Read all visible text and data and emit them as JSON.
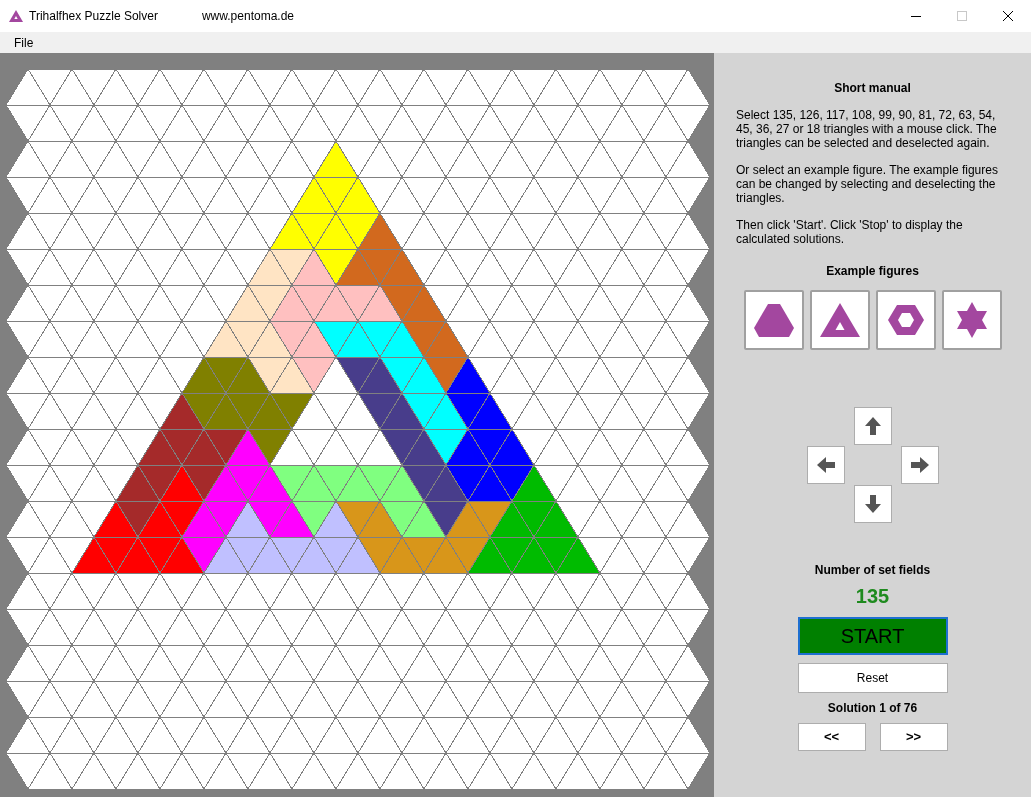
{
  "window": {
    "title": "Trihalfhex Puzzle Solver",
    "subtitle": "www.pentoma.de"
  },
  "menu": [
    "File"
  ],
  "board": {
    "rows": [
      [
        {
          "color": "#ffffff"
        },
        {
          "color": "#ffffff"
        },
        {
          "color": "#ffffff"
        },
        {
          "color": "#ffffff"
        },
        {
          "color": "#ffffff"
        },
        {
          "color": "#ffffff"
        },
        {
          "color": "#ffffff"
        },
        {
          "color": "#ffffff"
        },
        {
          "color": "#ffffff"
        },
        {
          "color": "#ffffff"
        },
        {
          "color": "#ffffff"
        },
        {
          "color": "#ffffff"
        },
        {
          "color": "#ffffff"
        },
        {
          "color": "#ffffff"
        },
        {
          "color": "#ffffff"
        },
        {
          "color": "#ffffff"
        },
        {
          "color": "#ffffff"
        },
        {
          "color": "#ffffff"
        },
        {
          "color": "#ffffff"
        },
        {
          "color": "#ffffff"
        },
        {
          "color": "#ffffff"
        },
        {
          "color": "#ffffff"
        },
        {
          "color": "#ffffff"
        },
        {
          "color": "#ffffff"
        },
        {
          "color": "#ffffff"
        },
        {
          "color": "#ffffff"
        },
        {
          "color": "#ffffff"
        },
        {
          "color": "#ffffff"
        },
        {
          "color": "#ffffff"
        },
        {
          "color": "#ffffff"
        },
        {
          "color": "#ffffff"
        }
      ],
      [
        {
          "color": "#ffffff"
        },
        {
          "color": "#ffffff"
        },
        {
          "color": "#ffffff"
        },
        {
          "color": "#ffffff"
        },
        {
          "color": "#ffffff"
        },
        {
          "color": "#ffffff"
        },
        {
          "color": "#ffffff"
        },
        {
          "color": "#ffffff"
        },
        {
          "color": "#ffffff"
        },
        {
          "color": "#ffffff"
        },
        {
          "color": "#ffffff"
        },
        {
          "color": "#ffffff"
        },
        {
          "color": "#ffffff"
        },
        {
          "color": "#ffffff"
        },
        {
          "color": "#ffffff"
        },
        {
          "color": "#ffffff"
        },
        {
          "color": "#ffffff"
        },
        {
          "color": "#ffffff"
        },
        {
          "color": "#ffffff"
        },
        {
          "color": "#ffffff"
        },
        {
          "color": "#ffffff"
        },
        {
          "color": "#ffffff"
        },
        {
          "color": "#ffffff"
        },
        {
          "color": "#ffffff"
        },
        {
          "color": "#ffffff"
        },
        {
          "color": "#ffffff"
        },
        {
          "color": "#ffffff"
        },
        {
          "color": "#ffffff"
        },
        {
          "color": "#ffffff"
        },
        {
          "color": "#ffffff"
        },
        {
          "color": "#ffffff"
        }
      ],
      [
        {
          "color": "#ffffff"
        },
        {
          "color": "#ffffff"
        },
        {
          "color": "#ffffff"
        },
        {
          "color": "#ffffff"
        },
        {
          "color": "#ffffff"
        },
        {
          "color": "#ffffff"
        },
        {
          "color": "#ffffff"
        },
        {
          "color": "#ffffff"
        },
        {
          "color": "#ffffff"
        },
        {
          "color": "#ffffff"
        },
        {
          "color": "#ffffff"
        },
        {
          "color": "#ffffff"
        },
        {
          "color": "#ffffff"
        },
        {
          "color": "#ffffff"
        },
        {
          "color": "#ffff00"
        },
        {
          "color": "#ffffff"
        },
        {
          "color": "#ffffff"
        },
        {
          "color": "#ffffff"
        },
        {
          "color": "#ffffff"
        },
        {
          "color": "#ffffff"
        },
        {
          "color": "#ffffff"
        },
        {
          "color": "#ffffff"
        },
        {
          "color": "#ffffff"
        },
        {
          "color": "#ffffff"
        },
        {
          "color": "#ffffff"
        },
        {
          "color": "#ffffff"
        },
        {
          "color": "#ffffff"
        },
        {
          "color": "#ffffff"
        },
        {
          "color": "#ffffff"
        },
        {
          "color": "#ffffff"
        },
        {
          "color": "#ffffff"
        }
      ],
      [
        {
          "color": "#ffffff"
        },
        {
          "color": "#ffffff"
        },
        {
          "color": "#ffffff"
        },
        {
          "color": "#ffffff"
        },
        {
          "color": "#ffffff"
        },
        {
          "color": "#ffffff"
        },
        {
          "color": "#ffffff"
        },
        {
          "color": "#ffffff"
        },
        {
          "color": "#ffffff"
        },
        {
          "color": "#ffffff"
        },
        {
          "color": "#ffffff"
        },
        {
          "color": "#ffffff"
        },
        {
          "color": "#ffffff"
        },
        {
          "color": "#ffff00"
        },
        {
          "color": "#ffff00"
        },
        {
          "color": "#ffff00"
        },
        {
          "color": "#ffffff"
        },
        {
          "color": "#ffffff"
        },
        {
          "color": "#ffffff"
        },
        {
          "color": "#ffffff"
        },
        {
          "color": "#ffffff"
        },
        {
          "color": "#ffffff"
        },
        {
          "color": "#ffffff"
        },
        {
          "color": "#ffffff"
        },
        {
          "color": "#ffffff"
        },
        {
          "color": "#ffffff"
        },
        {
          "color": "#ffffff"
        },
        {
          "color": "#ffffff"
        },
        {
          "color": "#ffffff"
        },
        {
          "color": "#ffffff"
        },
        {
          "color": "#ffffff"
        }
      ],
      [
        {
          "color": "#ffffff"
        },
        {
          "color": "#ffffff"
        },
        {
          "color": "#ffffff"
        },
        {
          "color": "#ffffff"
        },
        {
          "color": "#ffffff"
        },
        {
          "color": "#ffffff"
        },
        {
          "color": "#ffffff"
        },
        {
          "color": "#ffffff"
        },
        {
          "color": "#ffffff"
        },
        {
          "color": "#ffffff"
        },
        {
          "color": "#ffffff"
        },
        {
          "color": "#ffffff"
        },
        {
          "color": "#ffff00"
        },
        {
          "color": "#ffff00"
        },
        {
          "color": "#ffff00"
        },
        {
          "color": "#ffff00"
        },
        {
          "color": "#d2691e"
        },
        {
          "color": "#ffffff"
        },
        {
          "color": "#ffffff"
        },
        {
          "color": "#ffffff"
        },
        {
          "color": "#ffffff"
        },
        {
          "color": "#ffffff"
        },
        {
          "color": "#ffffff"
        },
        {
          "color": "#ffffff"
        },
        {
          "color": "#ffffff"
        },
        {
          "color": "#ffffff"
        },
        {
          "color": "#ffffff"
        },
        {
          "color": "#ffffff"
        },
        {
          "color": "#ffffff"
        },
        {
          "color": "#ffffff"
        },
        {
          "color": "#ffffff"
        }
      ],
      [
        {
          "color": "#ffffff"
        },
        {
          "color": "#ffffff"
        },
        {
          "color": "#ffffff"
        },
        {
          "color": "#ffffff"
        },
        {
          "color": "#ffffff"
        },
        {
          "color": "#ffffff"
        },
        {
          "color": "#ffffff"
        },
        {
          "color": "#ffffff"
        },
        {
          "color": "#ffffff"
        },
        {
          "color": "#ffffff"
        },
        {
          "color": "#ffffff"
        },
        {
          "color": "#ffe4c4"
        },
        {
          "color": "#ffe4c4"
        },
        {
          "color": "#ffc0c0"
        },
        {
          "color": "#ffff00"
        },
        {
          "color": "#d2691e"
        },
        {
          "color": "#d2691e"
        },
        {
          "color": "#d2691e"
        },
        {
          "color": "#ffffff"
        },
        {
          "color": "#ffffff"
        },
        {
          "color": "#ffffff"
        },
        {
          "color": "#ffffff"
        },
        {
          "color": "#ffffff"
        },
        {
          "color": "#ffffff"
        },
        {
          "color": "#ffffff"
        },
        {
          "color": "#ffffff"
        },
        {
          "color": "#ffffff"
        },
        {
          "color": "#ffffff"
        },
        {
          "color": "#ffffff"
        },
        {
          "color": "#ffffff"
        },
        {
          "color": "#ffffff"
        }
      ],
      [
        {
          "color": "#ffffff"
        },
        {
          "color": "#ffffff"
        },
        {
          "color": "#ffffff"
        },
        {
          "color": "#ffffff"
        },
        {
          "color": "#ffffff"
        },
        {
          "color": "#ffffff"
        },
        {
          "color": "#ffffff"
        },
        {
          "color": "#ffffff"
        },
        {
          "color": "#ffffff"
        },
        {
          "color": "#ffffff"
        },
        {
          "color": "#ffe4c4"
        },
        {
          "color": "#ffe4c4"
        },
        {
          "color": "#ffc0c0"
        },
        {
          "color": "#ffc0c0"
        },
        {
          "color": "#ffc0c0"
        },
        {
          "color": "#ffc0c0"
        },
        {
          "color": "#ffc0c0"
        },
        {
          "color": "#d2691e"
        },
        {
          "color": "#d2691e"
        },
        {
          "color": "#ffffff"
        },
        {
          "color": "#ffffff"
        },
        {
          "color": "#ffffff"
        },
        {
          "color": "#ffffff"
        },
        {
          "color": "#ffffff"
        },
        {
          "color": "#ffffff"
        },
        {
          "color": "#ffffff"
        },
        {
          "color": "#ffffff"
        },
        {
          "color": "#ffffff"
        },
        {
          "color": "#ffffff"
        },
        {
          "color": "#ffffff"
        },
        {
          "color": "#ffffff"
        }
      ],
      [
        {
          "color": "#ffffff"
        },
        {
          "color": "#ffffff"
        },
        {
          "color": "#ffffff"
        },
        {
          "color": "#ffffff"
        },
        {
          "color": "#ffffff"
        },
        {
          "color": "#ffffff"
        },
        {
          "color": "#ffffff"
        },
        {
          "color": "#ffffff"
        },
        {
          "color": "#ffffff"
        },
        {
          "color": "#ffe4c4"
        },
        {
          "color": "#ffe4c4"
        },
        {
          "color": "#ffe4c4"
        },
        {
          "color": "#ffc0c0"
        },
        {
          "color": "#ffc0c0"
        },
        {
          "color": "#00ffff"
        },
        {
          "color": "#00ffff"
        },
        {
          "color": "#00ffff"
        },
        {
          "color": "#00ffff"
        },
        {
          "color": "#d2691e"
        },
        {
          "color": "#d2691e"
        },
        {
          "color": "#ffffff"
        },
        {
          "color": "#ffffff"
        },
        {
          "color": "#ffffff"
        },
        {
          "color": "#ffffff"
        },
        {
          "color": "#ffffff"
        },
        {
          "color": "#ffffff"
        },
        {
          "color": "#ffffff"
        },
        {
          "color": "#ffffff"
        },
        {
          "color": "#ffffff"
        },
        {
          "color": "#ffffff"
        },
        {
          "color": "#ffffff"
        }
      ],
      [
        {
          "color": "#ffffff"
        },
        {
          "color": "#ffffff"
        },
        {
          "color": "#ffffff"
        },
        {
          "color": "#ffffff"
        },
        {
          "color": "#ffffff"
        },
        {
          "color": "#ffffff"
        },
        {
          "color": "#ffffff"
        },
        {
          "color": "#ffffff"
        },
        {
          "color": "#808000"
        },
        {
          "color": "#808000"
        },
        {
          "color": "#808000"
        },
        {
          "color": "#ffe4c4"
        },
        {
          "color": "#ffe4c4"
        },
        {
          "color": "#ffc0c0"
        },
        {
          "color": "#ffffff"
        },
        {
          "color": "#483d8b"
        },
        {
          "color": "#483d8b"
        },
        {
          "color": "#00ffff"
        },
        {
          "color": "#00ffff"
        },
        {
          "color": "#d2691e"
        },
        {
          "color": "#0000ff"
        },
        {
          "color": "#ffffff"
        },
        {
          "color": "#ffffff"
        },
        {
          "color": "#ffffff"
        },
        {
          "color": "#ffffff"
        },
        {
          "color": "#ffffff"
        },
        {
          "color": "#ffffff"
        },
        {
          "color": "#ffffff"
        },
        {
          "color": "#ffffff"
        },
        {
          "color": "#ffffff"
        },
        {
          "color": "#ffffff"
        }
      ],
      [
        {
          "color": "#ffffff"
        },
        {
          "color": "#ffffff"
        },
        {
          "color": "#ffffff"
        },
        {
          "color": "#ffffff"
        },
        {
          "color": "#ffffff"
        },
        {
          "color": "#ffffff"
        },
        {
          "color": "#ffffff"
        },
        {
          "color": "#a52a2a"
        },
        {
          "color": "#808000"
        },
        {
          "color": "#808000"
        },
        {
          "color": "#808000"
        },
        {
          "color": "#808000"
        },
        {
          "color": "#808000"
        },
        {
          "color": "#ffffff"
        },
        {
          "color": "#ffffff"
        },
        {
          "color": "#ffffff"
        },
        {
          "color": "#483d8b"
        },
        {
          "color": "#483d8b"
        },
        {
          "color": "#00ffff"
        },
        {
          "color": "#00ffff"
        },
        {
          "color": "#0000ff"
        },
        {
          "color": "#0000ff"
        },
        {
          "color": "#ffffff"
        },
        {
          "color": "#ffffff"
        },
        {
          "color": "#ffffff"
        },
        {
          "color": "#ffffff"
        },
        {
          "color": "#ffffff"
        },
        {
          "color": "#ffffff"
        },
        {
          "color": "#ffffff"
        },
        {
          "color": "#ffffff"
        },
        {
          "color": "#ffffff"
        }
      ],
      [
        {
          "color": "#ffffff"
        },
        {
          "color": "#ffffff"
        },
        {
          "color": "#ffffff"
        },
        {
          "color": "#ffffff"
        },
        {
          "color": "#ffffff"
        },
        {
          "color": "#ffffff"
        },
        {
          "color": "#a52a2a"
        },
        {
          "color": "#a52a2a"
        },
        {
          "color": "#a52a2a"
        },
        {
          "color": "#a52a2a"
        },
        {
          "color": "#ff00ff"
        },
        {
          "color": "#808000"
        },
        {
          "color": "#ffffff"
        },
        {
          "color": "#ffffff"
        },
        {
          "color": "#ffffff"
        },
        {
          "color": "#ffffff"
        },
        {
          "color": "#ffffff"
        },
        {
          "color": "#483d8b"
        },
        {
          "color": "#483d8b"
        },
        {
          "color": "#00ffff"
        },
        {
          "color": "#0000ff"
        },
        {
          "color": "#0000ff"
        },
        {
          "color": "#0000ff"
        },
        {
          "color": "#ffffff"
        },
        {
          "color": "#ffffff"
        },
        {
          "color": "#ffffff"
        },
        {
          "color": "#ffffff"
        },
        {
          "color": "#ffffff"
        },
        {
          "color": "#ffffff"
        },
        {
          "color": "#ffffff"
        },
        {
          "color": "#ffffff"
        }
      ],
      [
        {
          "color": "#ffffff"
        },
        {
          "color": "#ffffff"
        },
        {
          "color": "#ffffff"
        },
        {
          "color": "#ffffff"
        },
        {
          "color": "#ffffff"
        },
        {
          "color": "#a52a2a"
        },
        {
          "color": "#a52a2a"
        },
        {
          "color": "#ff0000"
        },
        {
          "color": "#a52a2a"
        },
        {
          "color": "#ff00ff"
        },
        {
          "color": "#ff00ff"
        },
        {
          "color": "#ff00ff"
        },
        {
          "color": "#80ff80"
        },
        {
          "color": "#80ff80"
        },
        {
          "color": "#80ff80"
        },
        {
          "color": "#80ff80"
        },
        {
          "color": "#80ff80"
        },
        {
          "color": "#80ff80"
        },
        {
          "color": "#483d8b"
        },
        {
          "color": "#483d8b"
        },
        {
          "color": "#0000ff"
        },
        {
          "color": "#0000ff"
        },
        {
          "color": "#0000ff"
        },
        {
          "color": "#00bb00"
        },
        {
          "color": "#ffffff"
        },
        {
          "color": "#ffffff"
        },
        {
          "color": "#ffffff"
        },
        {
          "color": "#ffffff"
        },
        {
          "color": "#ffffff"
        },
        {
          "color": "#ffffff"
        },
        {
          "color": "#ffffff"
        }
      ],
      [
        {
          "color": "#ffffff"
        },
        {
          "color": "#ffffff"
        },
        {
          "color": "#ffffff"
        },
        {
          "color": "#ffffff"
        },
        {
          "color": "#ff0000"
        },
        {
          "color": "#a52a2a"
        },
        {
          "color": "#ff0000"
        },
        {
          "color": "#ff0000"
        },
        {
          "color": "#ff00ff"
        },
        {
          "color": "#ff00ff"
        },
        {
          "color": "#c0c0ff"
        },
        {
          "color": "#ff00ff"
        },
        {
          "color": "#ff00ff"
        },
        {
          "color": "#80ff80"
        },
        {
          "color": "#c0c0ff"
        },
        {
          "color": "#d8961a"
        },
        {
          "color": "#d8961a"
        },
        {
          "color": "#80ff80"
        },
        {
          "color": "#80ff80"
        },
        {
          "color": "#483d8b"
        },
        {
          "color": "#d8961a"
        },
        {
          "color": "#d8961a"
        },
        {
          "color": "#00bb00"
        },
        {
          "color": "#00bb00"
        },
        {
          "color": "#00bb00"
        },
        {
          "color": "#ffffff"
        },
        {
          "color": "#ffffff"
        },
        {
          "color": "#ffffff"
        },
        {
          "color": "#ffffff"
        },
        {
          "color": "#ffffff"
        },
        {
          "color": "#ffffff"
        }
      ],
      [
        {
          "color": "#ffffff"
        },
        {
          "color": "#ffffff"
        },
        {
          "color": "#ffffff"
        },
        {
          "color": "#ff0000"
        },
        {
          "color": "#ff0000"
        },
        {
          "color": "#ff0000"
        },
        {
          "color": "#ff0000"
        },
        {
          "color": "#ff0000"
        },
        {
          "color": "#ff00ff"
        },
        {
          "color": "#c0c0ff"
        },
        {
          "color": "#c0c0ff"
        },
        {
          "color": "#c0c0ff"
        },
        {
          "color": "#c0c0ff"
        },
        {
          "color": "#c0c0ff"
        },
        {
          "color": "#c0c0ff"
        },
        {
          "color": "#c0c0ff"
        },
        {
          "color": "#d8961a"
        },
        {
          "color": "#d8961a"
        },
        {
          "color": "#d8961a"
        },
        {
          "color": "#d8961a"
        },
        {
          "color": "#d8961a"
        },
        {
          "color": "#00bb00"
        },
        {
          "color": "#00bb00"
        },
        {
          "color": "#00bb00"
        },
        {
          "color": "#00bb00"
        },
        {
          "color": "#00bb00"
        },
        {
          "color": "#ffffff"
        },
        {
          "color": "#ffffff"
        },
        {
          "color": "#ffffff"
        },
        {
          "color": "#ffffff"
        },
        {
          "color": "#ffffff"
        }
      ],
      [
        {
          "color": "#ffffff"
        },
        {
          "color": "#ffffff"
        },
        {
          "color": "#ffffff"
        },
        {
          "color": "#ffffff"
        },
        {
          "color": "#ffffff"
        },
        {
          "color": "#ffffff"
        },
        {
          "color": "#ffffff"
        },
        {
          "color": "#ffffff"
        },
        {
          "color": "#ffffff"
        },
        {
          "color": "#ffffff"
        },
        {
          "color": "#ffffff"
        },
        {
          "color": "#ffffff"
        },
        {
          "color": "#ffffff"
        },
        {
          "color": "#ffffff"
        },
        {
          "color": "#ffffff"
        },
        {
          "color": "#ffffff"
        },
        {
          "color": "#ffffff"
        },
        {
          "color": "#ffffff"
        },
        {
          "color": "#ffffff"
        },
        {
          "color": "#ffffff"
        },
        {
          "color": "#ffffff"
        },
        {
          "color": "#ffffff"
        },
        {
          "color": "#ffffff"
        },
        {
          "color": "#ffffff"
        },
        {
          "color": "#ffffff"
        },
        {
          "color": "#ffffff"
        },
        {
          "color": "#ffffff"
        },
        {
          "color": "#ffffff"
        },
        {
          "color": "#ffffff"
        },
        {
          "color": "#ffffff"
        },
        {
          "color": "#ffffff"
        }
      ],
      [
        {
          "color": "#ffffff"
        },
        {
          "color": "#ffffff"
        },
        {
          "color": "#ffffff"
        },
        {
          "color": "#ffffff"
        },
        {
          "color": "#ffffff"
        },
        {
          "color": "#ffffff"
        },
        {
          "color": "#ffffff"
        },
        {
          "color": "#ffffff"
        },
        {
          "color": "#ffffff"
        },
        {
          "color": "#ffffff"
        },
        {
          "color": "#ffffff"
        },
        {
          "color": "#ffffff"
        },
        {
          "color": "#ffffff"
        },
        {
          "color": "#ffffff"
        },
        {
          "color": "#ffffff"
        },
        {
          "color": "#ffffff"
        },
        {
          "color": "#ffffff"
        },
        {
          "color": "#ffffff"
        },
        {
          "color": "#ffffff"
        },
        {
          "color": "#ffffff"
        },
        {
          "color": "#ffffff"
        },
        {
          "color": "#ffffff"
        },
        {
          "color": "#ffffff"
        },
        {
          "color": "#ffffff"
        },
        {
          "color": "#ffffff"
        },
        {
          "color": "#ffffff"
        },
        {
          "color": "#ffffff"
        },
        {
          "color": "#ffffff"
        },
        {
          "color": "#ffffff"
        },
        {
          "color": "#ffffff"
        },
        {
          "color": "#ffffff"
        }
      ],
      [
        {
          "color": "#ffffff"
        },
        {
          "color": "#ffffff"
        },
        {
          "color": "#ffffff"
        },
        {
          "color": "#ffffff"
        },
        {
          "color": "#ffffff"
        },
        {
          "color": "#ffffff"
        },
        {
          "color": "#ffffff"
        },
        {
          "color": "#ffffff"
        },
        {
          "color": "#ffffff"
        },
        {
          "color": "#ffffff"
        },
        {
          "color": "#ffffff"
        },
        {
          "color": "#ffffff"
        },
        {
          "color": "#ffffff"
        },
        {
          "color": "#ffffff"
        },
        {
          "color": "#ffffff"
        },
        {
          "color": "#ffffff"
        },
        {
          "color": "#ffffff"
        },
        {
          "color": "#ffffff"
        },
        {
          "color": "#ffffff"
        },
        {
          "color": "#ffffff"
        },
        {
          "color": "#ffffff"
        },
        {
          "color": "#ffffff"
        },
        {
          "color": "#ffffff"
        },
        {
          "color": "#ffffff"
        },
        {
          "color": "#ffffff"
        },
        {
          "color": "#ffffff"
        },
        {
          "color": "#ffffff"
        },
        {
          "color": "#ffffff"
        },
        {
          "color": "#ffffff"
        },
        {
          "color": "#ffffff"
        },
        {
          "color": "#ffffff"
        }
      ],
      [
        {
          "color": "#ffffff"
        },
        {
          "color": "#ffffff"
        },
        {
          "color": "#ffffff"
        },
        {
          "color": "#ffffff"
        },
        {
          "color": "#ffffff"
        },
        {
          "color": "#ffffff"
        },
        {
          "color": "#ffffff"
        },
        {
          "color": "#ffffff"
        },
        {
          "color": "#ffffff"
        },
        {
          "color": "#ffffff"
        },
        {
          "color": "#ffffff"
        },
        {
          "color": "#ffffff"
        },
        {
          "color": "#ffffff"
        },
        {
          "color": "#ffffff"
        },
        {
          "color": "#ffffff"
        },
        {
          "color": "#ffffff"
        },
        {
          "color": "#ffffff"
        },
        {
          "color": "#ffffff"
        },
        {
          "color": "#ffffff"
        },
        {
          "color": "#ffffff"
        },
        {
          "color": "#ffffff"
        },
        {
          "color": "#ffffff"
        },
        {
          "color": "#ffffff"
        },
        {
          "color": "#ffffff"
        },
        {
          "color": "#ffffff"
        },
        {
          "color": "#ffffff"
        },
        {
          "color": "#ffffff"
        },
        {
          "color": "#ffffff"
        },
        {
          "color": "#ffffff"
        },
        {
          "color": "#ffffff"
        },
        {
          "color": "#ffffff"
        }
      ],
      [
        {
          "color": "#ffffff"
        },
        {
          "color": "#ffffff"
        },
        {
          "color": "#ffffff"
        },
        {
          "color": "#ffffff"
        },
        {
          "color": "#ffffff"
        },
        {
          "color": "#ffffff"
        },
        {
          "color": "#ffffff"
        },
        {
          "color": "#ffffff"
        },
        {
          "color": "#ffffff"
        },
        {
          "color": "#ffffff"
        },
        {
          "color": "#ffffff"
        },
        {
          "color": "#ffffff"
        },
        {
          "color": "#ffffff"
        },
        {
          "color": "#ffffff"
        },
        {
          "color": "#ffffff"
        },
        {
          "color": "#ffffff"
        },
        {
          "color": "#ffffff"
        },
        {
          "color": "#ffffff"
        },
        {
          "color": "#ffffff"
        },
        {
          "color": "#ffffff"
        },
        {
          "color": "#ffffff"
        },
        {
          "color": "#ffffff"
        },
        {
          "color": "#ffffff"
        },
        {
          "color": "#ffffff"
        },
        {
          "color": "#ffffff"
        },
        {
          "color": "#ffffff"
        },
        {
          "color": "#ffffff"
        },
        {
          "color": "#ffffff"
        },
        {
          "color": "#ffffff"
        },
        {
          "color": "#ffffff"
        },
        {
          "color": "#ffffff"
        }
      ],
      [
        {
          "color": "#ffffff"
        },
        {
          "color": "#ffffff"
        },
        {
          "color": "#ffffff"
        },
        {
          "color": "#ffffff"
        },
        {
          "color": "#ffffff"
        },
        {
          "color": "#ffffff"
        },
        {
          "color": "#ffffff"
        },
        {
          "color": "#ffffff"
        },
        {
          "color": "#ffffff"
        },
        {
          "color": "#ffffff"
        },
        {
          "color": "#ffffff"
        },
        {
          "color": "#ffffff"
        },
        {
          "color": "#ffffff"
        },
        {
          "color": "#ffffff"
        },
        {
          "color": "#ffffff"
        },
        {
          "color": "#ffffff"
        },
        {
          "color": "#ffffff"
        },
        {
          "color": "#ffffff"
        },
        {
          "color": "#ffffff"
        },
        {
          "color": "#ffffff"
        },
        {
          "color": "#ffffff"
        },
        {
          "color": "#ffffff"
        },
        {
          "color": "#ffffff"
        },
        {
          "color": "#ffffff"
        },
        {
          "color": "#ffffff"
        },
        {
          "color": "#ffffff"
        },
        {
          "color": "#ffffff"
        },
        {
          "color": "#ffffff"
        },
        {
          "color": "#ffffff"
        },
        {
          "color": "#ffffff"
        },
        {
          "color": "#ffffff"
        }
      ]
    ]
  },
  "manual": {
    "title": "Short manual",
    "paragraphs": [
      "Select 135, 126, 117, 108, 99, 90, 81, 72, 63, 54, 45, 36, 27 or 18 triangles with a mouse click. The triangles can be selected and deselected again.",
      "Or select an example figure. The example figures can be changed by selecting and deselecting the triangles.",
      "Then click 'Start'. Click 'Stop' to display the calculated solutions."
    ]
  },
  "examples": {
    "title": "Example figures",
    "figures": [
      {
        "kind": "truncated-triangle"
      },
      {
        "kind": "hollow-triangle"
      },
      {
        "kind": "hollow-hexagon"
      },
      {
        "kind": "star"
      }
    ]
  },
  "arrows": [
    {
      "kind": "up"
    },
    {
      "kind": "left"
    },
    {
      "kind": "right"
    },
    {
      "kind": "down"
    }
  ],
  "counter": {
    "label": "Number of set fields",
    "value": "135"
  },
  "start_button": "START",
  "reset_button": "Reset",
  "solution": "Solution 1 of 76",
  "nav_buttons": [
    "<<",
    ">>"
  ]
}
